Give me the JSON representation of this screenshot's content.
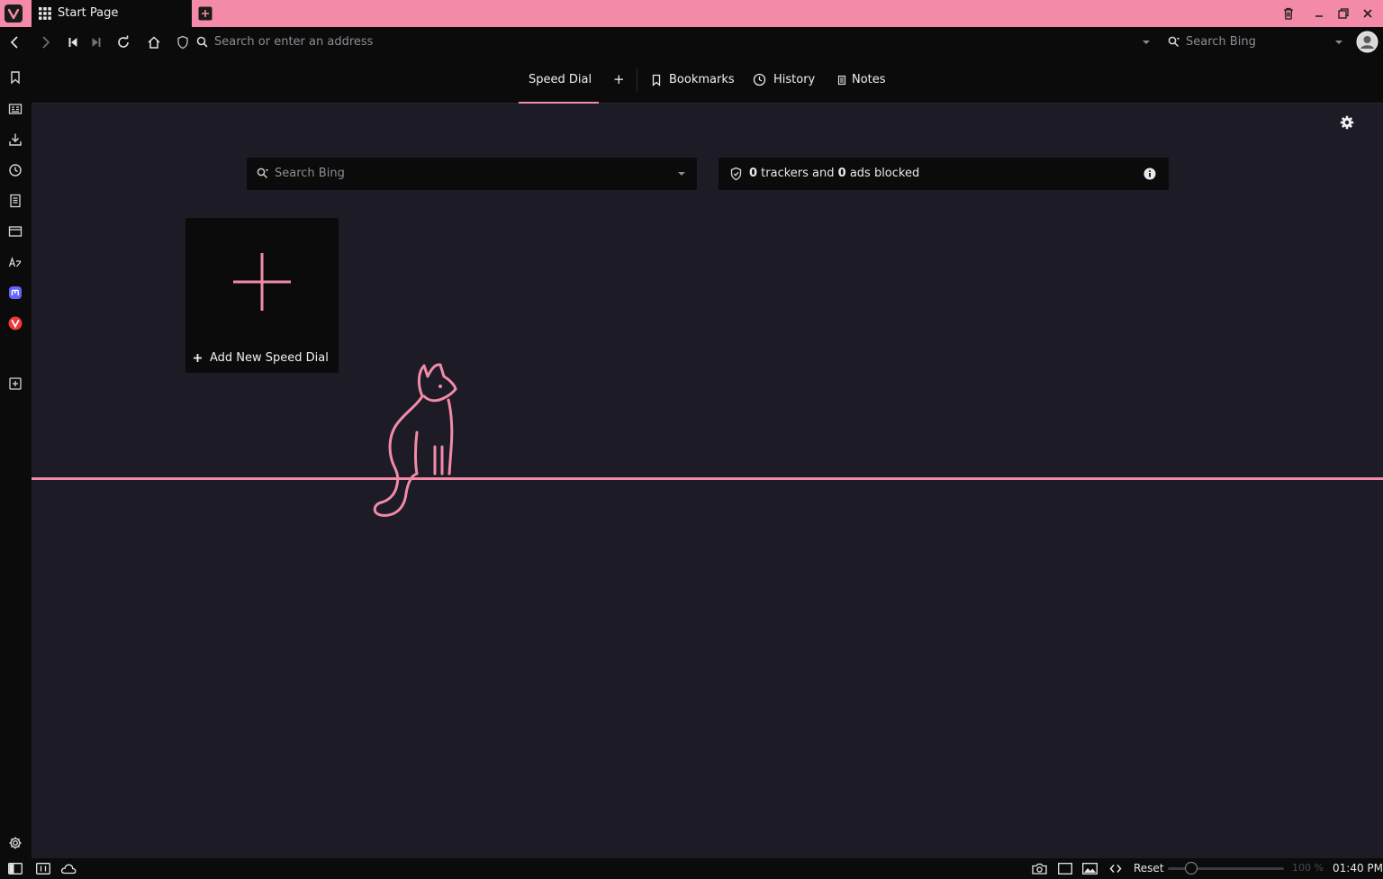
{
  "tab": {
    "title": "Start Page"
  },
  "address_bar": {
    "placeholder": "Search or enter an address",
    "search_engine_placeholder": "Search Bing"
  },
  "start_nav": {
    "speed_dial": "Speed Dial",
    "add": "+",
    "bookmarks": "Bookmarks",
    "history": "History",
    "notes": "Notes"
  },
  "start_page": {
    "search_placeholder": "Search Bing",
    "trackers_count": "0",
    "trackers_label": " trackers and ",
    "ads_count": "0",
    "ads_label": " ads blocked",
    "add_speed_dial": "Add New Speed Dial"
  },
  "status_bar": {
    "reset": "Reset",
    "zoom": "100 %",
    "time": "01:40 PM",
    "zoom_level": 0.2
  },
  "icons": {
    "tabbar": [
      "vivaldi-logo-icon",
      "tab-grid-icon",
      "new-tab-icon",
      "trash-icon",
      "minimize-icon",
      "restore-icon",
      "close-icon"
    ],
    "nav": [
      "back-icon",
      "forward-icon",
      "rewind-icon",
      "fast-forward-icon",
      "reload-icon",
      "home-icon",
      "shield-icon",
      "search-icon",
      "profile-icon"
    ],
    "sidebar": [
      "bookmarks-icon",
      "reading-list-icon",
      "downloads-icon",
      "history-icon",
      "notes-icon",
      "window-panel-icon",
      "translate-icon",
      "mastodon-icon",
      "vivaldi-icon",
      "add-panel-icon",
      "settings-icon"
    ]
  },
  "colors": {
    "accent": "#f38ba8",
    "background": "#1c1b26",
    "chrome": "#0b0b0b",
    "mastodon": "#6364ff",
    "vivaldi": "#ef3939"
  }
}
